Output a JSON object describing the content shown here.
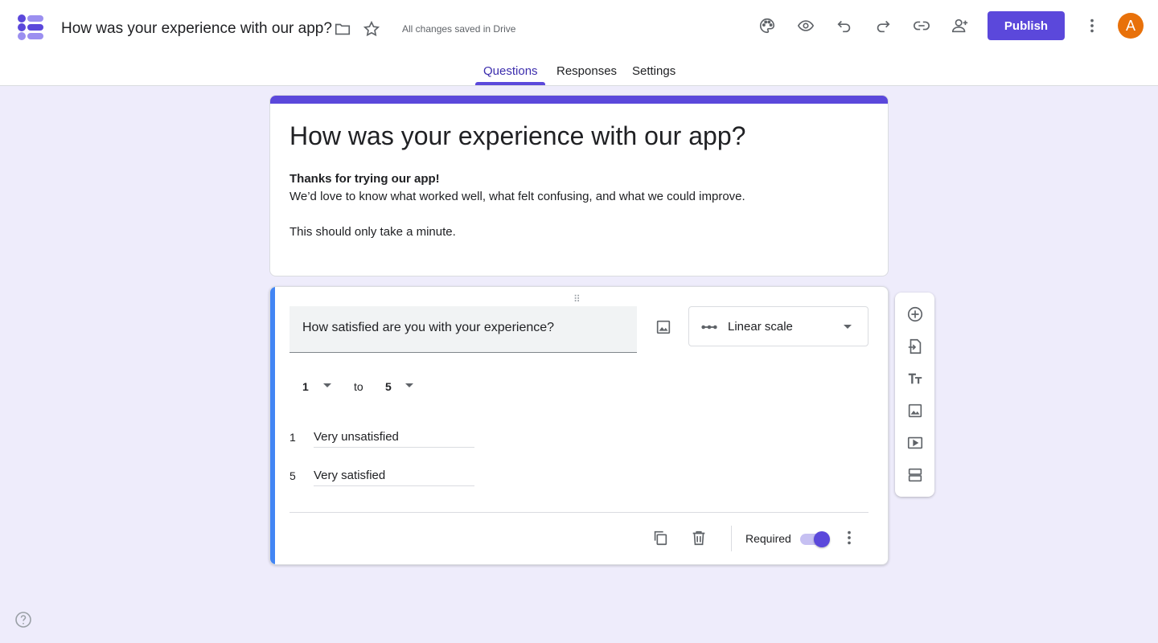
{
  "header": {
    "title": "How was your experience with our app?",
    "saved_status": "All changes saved in Drive",
    "publish_label": "Publish",
    "avatar_initial": "A",
    "accent_color": "#5b48db",
    "avatar_color": "#e8710a",
    "icons": [
      "folder-icon",
      "star-icon",
      "palette-icon",
      "eye-icon",
      "undo-icon",
      "redo-icon",
      "link-icon",
      "add-collaborator-icon",
      "more-vert-icon"
    ]
  },
  "tabs": [
    {
      "label": "Questions",
      "active": true
    },
    {
      "label": "Responses",
      "active": false
    },
    {
      "label": "Settings",
      "active": false
    }
  ],
  "form": {
    "title": "How was your experience with our app?",
    "description_bold": "Thanks for trying our app!",
    "description_line1": "We’d love to know what worked well, what felt confusing, and what we could improve.",
    "description_line2": "This should only take a minute."
  },
  "question": {
    "text": "How satisfied are you with your experience?",
    "type": "Linear scale",
    "scale_min": "1",
    "scale_to": "to",
    "scale_max": "5",
    "min_label_num": "1",
    "min_label": "Very unsatisfied",
    "max_label_num": "5",
    "max_label": "Very satisfied",
    "required_label": "Required",
    "required": true
  },
  "side_tools": [
    "add-question-icon",
    "import-questions-icon",
    "add-title-icon",
    "add-image-icon",
    "add-video-icon",
    "add-section-icon"
  ]
}
